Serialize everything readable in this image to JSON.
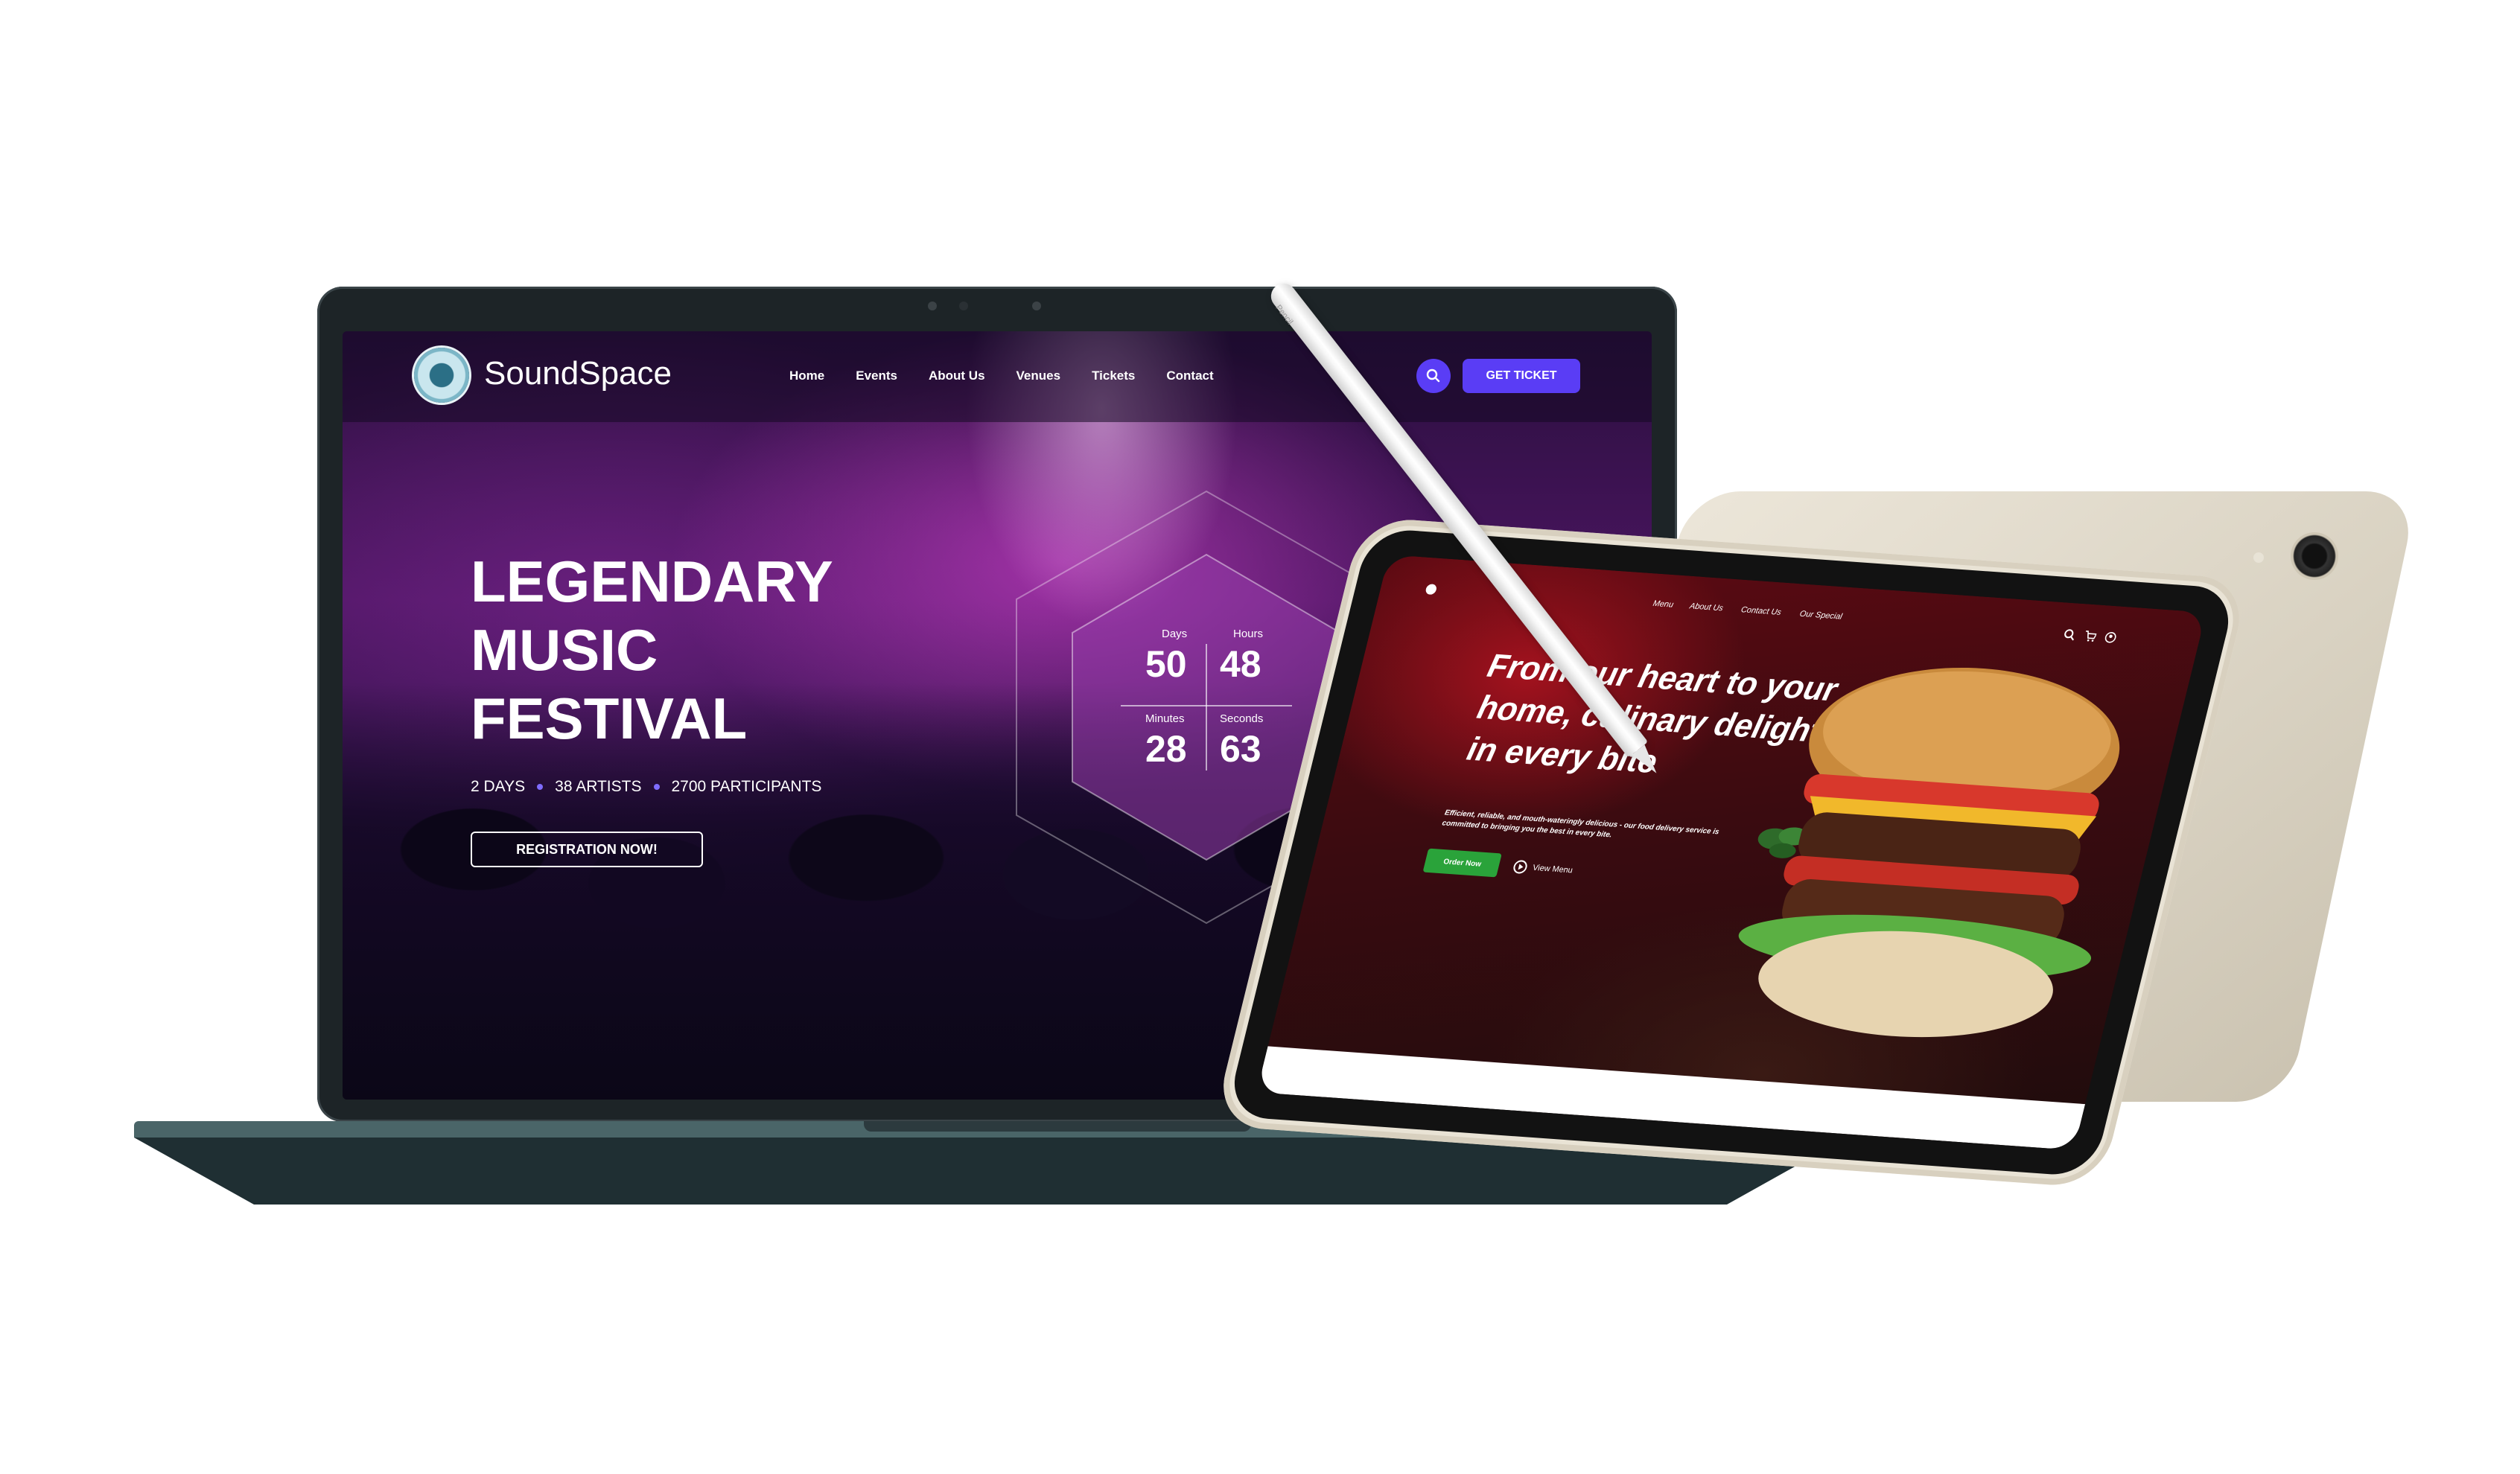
{
  "laptop_site": {
    "brand": "SoundSpace",
    "nav": [
      "Home",
      "Events",
      "About Us",
      "Venues",
      "Tickets",
      "Contact"
    ],
    "get_ticket": "GET TICKET",
    "hero_title": [
      "LEGENDARY",
      "MUSIC",
      "FESTIVAL"
    ],
    "stats": [
      "2 DAYS",
      "38 ARTISTS",
      "2700 PARTICIPANTS"
    ],
    "registration_button": "REGISTRATION NOW!",
    "countdown": {
      "days_label": "Days",
      "days": "50",
      "hours_label": "Hours",
      "hours": "48",
      "minutes_label": "Minutes",
      "minutes": "28",
      "seconds_label": "Seconds",
      "seconds": "63"
    },
    "accent_color": "#5a3df5"
  },
  "tablet_site": {
    "nav": [
      "Menu",
      "About Us",
      "Contact Us",
      "Our Special"
    ],
    "hero_title": [
      "From our heart to your",
      "home, culinary delight",
      "in every bite"
    ],
    "subtitle": "Efficient, reliable, and mouth-wateringly delicious - our food delivery service is committed to bringing you the best in every bite.",
    "order_button": "Order Now",
    "view_menu": "View Menu",
    "accent_color": "#2aa33a"
  },
  "pencil": {
    "label": "Pencil"
  }
}
